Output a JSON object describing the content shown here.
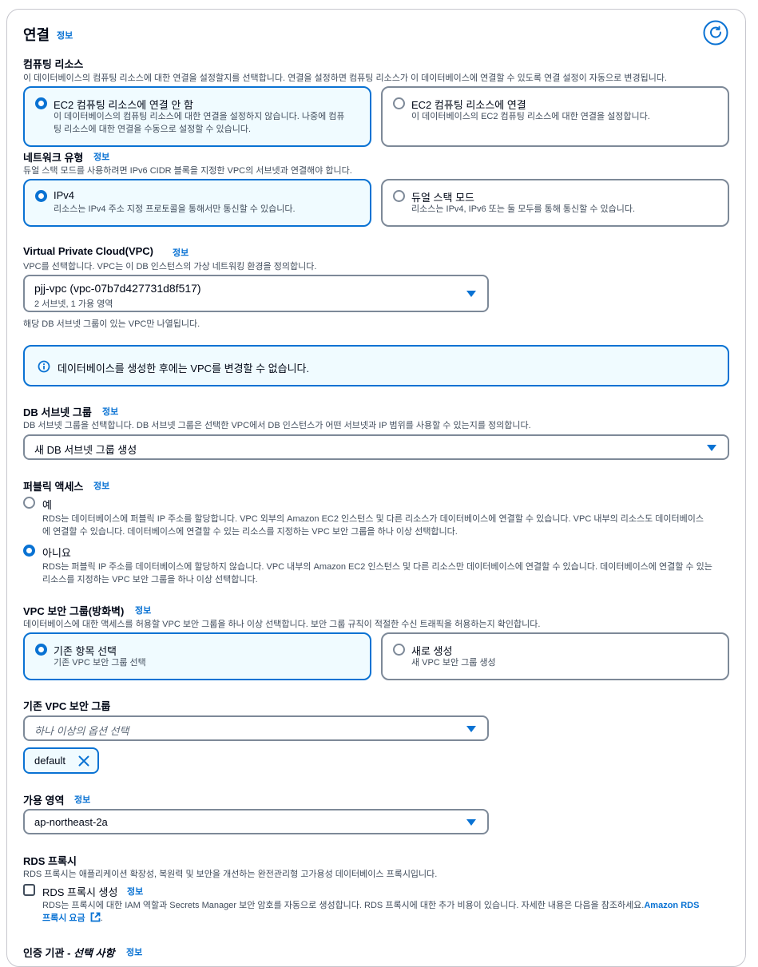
{
  "section": {
    "title": "연결",
    "info": "정보"
  },
  "compute": {
    "label": "컴퓨팅 리소스",
    "desc": "이 데이터베이스의 컴퓨팅 리소스에 대한 연결을 설정할지를 선택합니다. 연결을 설정하면 컴퓨팅 리소스가 이 데이터베이스에 연결할 수 있도록 연결 설정이 자동으로 변경됩니다.",
    "opt1_title": "EC2 컴퓨팅 리소스에 연결 안 함",
    "opt1_desc1": "이 데이터베이스의 컴퓨팅 리소스에 대한 연결을 설정하지 않습니다. 나중에 컴퓨",
    "opt1_desc2": "팅 리소스에 대한 연결을 수동으로 설정할 수 있습니다.",
    "opt2_title": "EC2 컴퓨팅 리소스에 연결",
    "opt2_desc": "이 데이터베이스의 EC2 컴퓨팅 리소스에 대한 연결을 설정합니다."
  },
  "network": {
    "label": "네트워크 유형",
    "info": "정보",
    "desc": "듀얼 스택 모드를 사용하려면 IPv6 CIDR 블록을 지정한 VPC의 서브넷과 연결해야 합니다.",
    "opt1_title": "IPv4",
    "opt1_desc": "리소스는 IPv4 주소 지정 프로토콜을 통해서만 통신할 수 있습니다.",
    "opt2_title": "듀얼 스택 모드",
    "opt2_desc": "리소스는 IPv4, IPv6 또는 둘 모두를 통해 통신할 수 있습니다."
  },
  "vpc": {
    "label": "Virtual Private Cloud(VPC)",
    "info": "정보",
    "desc": "VPC를 선택합니다. VPC는 이 DB 인스턴스의 가상 네트워킹 환경을 정의합니다.",
    "value": "pjj-vpc (vpc-07b7d427731d8f517)",
    "sub": "2 서브넷, 1 가용 영역",
    "hint": "해당 DB 서브넷 그룹이 있는 VPC만 나열됩니다.",
    "alert": "데이터베이스를 생성한 후에는 VPC를 변경할 수 없습니다."
  },
  "subnet": {
    "label": "DB 서브넷 그룹",
    "info": "정보",
    "desc": "DB 서브넷 그룹을 선택합니다. DB 서브넷 그룹은 선택한 VPC에서 DB 인스턴스가 어떤 서브넷과 IP 범위를 사용할 수 있는지를 정의합니다.",
    "value": "새 DB 서브넷 그룹 생성"
  },
  "public": {
    "label": "퍼블릭 액세스",
    "info": "정보",
    "yes_title": "예",
    "yes_desc1": "RDS는 데이터베이스에 퍼블릭 IP 주소를 할당합니다. VPC 외부의 Amazon EC2 인스턴스 및 다른 리소스가 데이터베이스에 연결할 수 있습니다. VPC 내부의 리소스도 데이터베이스",
    "yes_desc2": "에 연결할 수 있습니다. 데이터베이스에 연결할 수 있는 리소스를 지정하는 VPC 보안 그룹을 하나 이상 선택합니다.",
    "no_title": "아니요",
    "no_desc1": "RDS는 퍼블릭 IP 주소를 데이터베이스에 할당하지 않습니다. VPC 내부의 Amazon EC2 인스턴스 및 다른 리소스만 데이터베이스에 연결할 수 있습니다. 데이터베이스에 연결할 수 있는",
    "no_desc2": "리소스를 지정하는 VPC 보안 그룹을 하나 이상 선택합니다."
  },
  "sg": {
    "label": "VPC 보안 그룹(방화벽)",
    "info": "정보",
    "desc": "데이터베이스에 대한 액세스를 허용할 VPC 보안 그룹을 하나 이상 선택합니다. 보안 그룹 규칙이 적절한 수신 트래픽을 허용하는지 확인합니다.",
    "opt1_title": "기존 항목 선택",
    "opt1_desc": "기존 VPC 보안 그룹 선택",
    "opt2_title": "새로 생성",
    "opt2_desc": "새 VPC 보안 그룹 생성"
  },
  "existing_sg": {
    "label": "기존 VPC 보안 그룹",
    "placeholder": "하나 이상의 옵션 선택",
    "token": "default"
  },
  "az": {
    "label": "가용 영역",
    "info": "정보",
    "value": "ap-northeast-2a"
  },
  "proxy": {
    "label": "RDS 프록시",
    "desc": "RDS 프록시는 애플리케이션 확장성, 복원력 및 보안을 개선하는 완전관리형 고가용성 데이터베이스 프록시입니다.",
    "checkbox_label": "RDS 프록시 생성",
    "info": "정보",
    "cb_desc1": "RDS는 프록시에 대한 IAM 역할과 Secrets Manager 보안 암호를 자동으로 생성합니다. RDS 프록시에 대한 추가 비용이 있습니다. 자세한 내용은 다음을 참조하세요.",
    "cb_link1": "Amazon RDS",
    "cb_link2": "프록시 요금"
  },
  "ca": {
    "label_main": "인증 기관 - ",
    "label_opt": "선택 사항",
    "info": "정보"
  },
  "colors": {
    "accent": "#0972d3",
    "selected_bg": "#f0fbff",
    "border": "#7d8998",
    "text": "#000716",
    "muted": "#414d5c"
  }
}
